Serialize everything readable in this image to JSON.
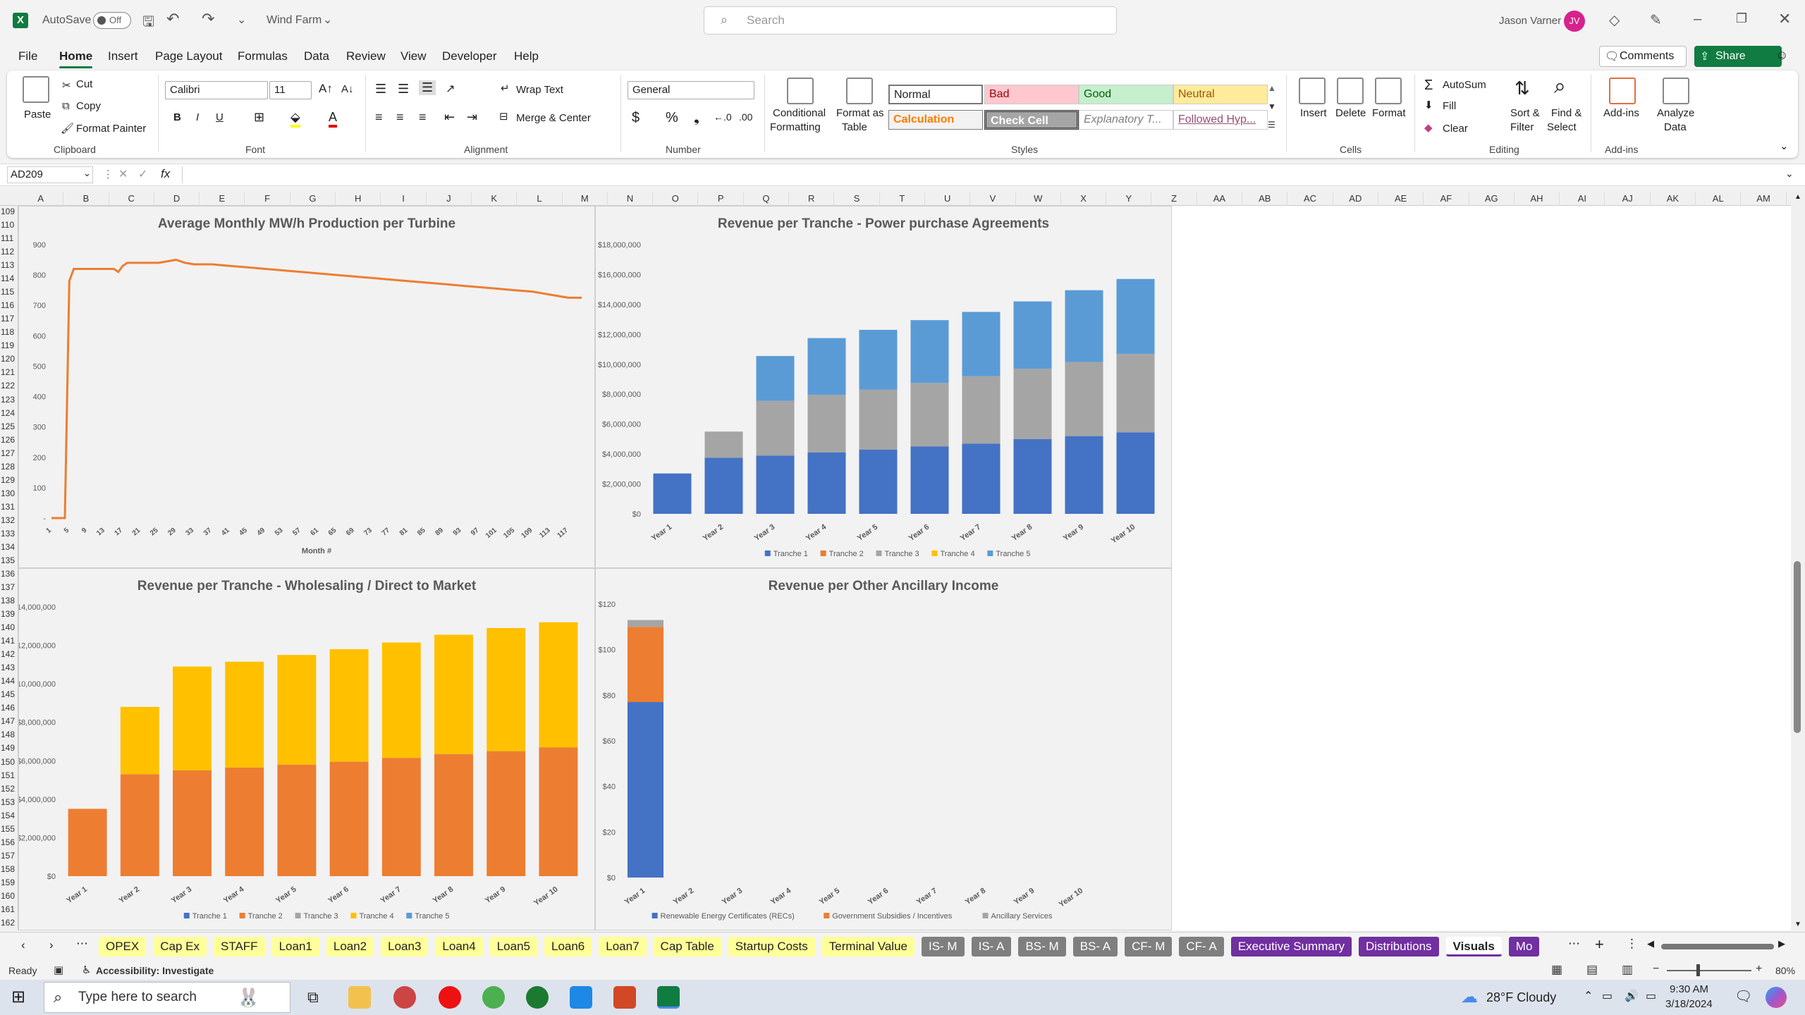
{
  "titlebar": {
    "autosave_label": "AutoSave",
    "autosave_state": "Off",
    "filename": "Wind Farm",
    "search_placeholder": "Search",
    "user_name": "Jason Varner",
    "user_initials": "JV"
  },
  "menu": [
    "File",
    "Home",
    "Insert",
    "Page Layout",
    "Formulas",
    "Data",
    "Review",
    "View",
    "Developer",
    "Help"
  ],
  "actions": {
    "comments": "Comments",
    "share": "Share"
  },
  "ribbon": {
    "clipboard": {
      "paste": "Paste",
      "cut": "Cut",
      "copy": "Copy",
      "format_painter": "Format Painter",
      "group": "Clipboard"
    },
    "font": {
      "name": "Calibri",
      "size": "11",
      "group": "Font"
    },
    "alignment": {
      "wrap": "Wrap Text",
      "merge": "Merge & Center",
      "group": "Alignment"
    },
    "number": {
      "format": "General",
      "group": "Number"
    },
    "styles": {
      "conditional": [
        "Conditional",
        "Formatting"
      ],
      "format_table": [
        "Format as",
        "Table"
      ],
      "cells": [
        "Normal",
        "Bad",
        "Good",
        "Neutral",
        "Calculation",
        "Check Cell",
        "Explanatory T...",
        "Followed Hyp..."
      ],
      "group": "Styles"
    },
    "cells": {
      "insert": "Insert",
      "delete": "Delete",
      "format": "Format",
      "group": "Cells"
    },
    "editing": {
      "autosum": "AutoSum",
      "fill": "Fill",
      "clear": "Clear",
      "sort": [
        "Sort &",
        "Filter"
      ],
      "find": [
        "Find &",
        "Select"
      ],
      "group": "Editing"
    },
    "addins": {
      "addins": "Add-ins",
      "analyze": [
        "Analyze",
        "Data"
      ],
      "group": "Add-ins"
    }
  },
  "formula_bar": {
    "name_box": "AD209",
    "fx": "fx",
    "value": ""
  },
  "columns": [
    "A",
    "B",
    "C",
    "D",
    "E",
    "F",
    "G",
    "H",
    "I",
    "J",
    "K",
    "L",
    "M",
    "N",
    "O",
    "P",
    "Q",
    "R",
    "S",
    "T",
    "U",
    "V",
    "W",
    "X",
    "Y",
    "Z",
    "AA",
    "AB",
    "AC",
    "AD",
    "AE",
    "AF",
    "AG",
    "AH",
    "AI",
    "AJ",
    "AK",
    "AL",
    "AM"
  ],
  "row_start": 109,
  "row_count": 54,
  "chart_data": [
    {
      "type": "line",
      "title": "Average Monthly MW/h Production per Turbine",
      "xlabel": "Month #",
      "ylabel": "",
      "ylim": [
        0,
        900
      ],
      "yticks": [
        "900",
        "800",
        "700",
        "600",
        "500",
        "400",
        "300",
        "200",
        "100",
        "-"
      ],
      "xticks": [
        "1",
        "5",
        "9",
        "13",
        "17",
        "21",
        "25",
        "29",
        "33",
        "37",
        "41",
        "45",
        "49",
        "53",
        "57",
        "61",
        "65",
        "69",
        "73",
        "77",
        "81",
        "85",
        "89",
        "93",
        "97",
        "101",
        "105",
        "109",
        "113",
        "117"
      ],
      "x": [
        1,
        2,
        3,
        4,
        5,
        6,
        9,
        13,
        15,
        16,
        17,
        18,
        21,
        25,
        29,
        31,
        33,
        37,
        41,
        45,
        49,
        53,
        57,
        61,
        65,
        69,
        73,
        77,
        81,
        85,
        89,
        93,
        97,
        101,
        105,
        109,
        113,
        117,
        120
      ],
      "y": [
        0,
        0,
        0,
        0,
        780,
        820,
        820,
        820,
        820,
        810,
        830,
        840,
        840,
        840,
        850,
        840,
        835,
        835,
        830,
        825,
        820,
        815,
        810,
        805,
        800,
        795,
        790,
        785,
        780,
        775,
        770,
        765,
        760,
        755,
        750,
        745,
        735,
        725,
        725
      ],
      "series": [
        {
          "name": "",
          "color": "#ed7d31"
        }
      ]
    },
    {
      "type": "bar",
      "stacked": true,
      "title": "Revenue per Tranche - Power purchase Agreements",
      "categories": [
        "Year 1",
        "Year 2",
        "Year 3",
        "Year 4",
        "Year 5",
        "Year 6",
        "Year 7",
        "Year 8",
        "Year 9",
        "Year 10"
      ],
      "ylim": [
        0,
        18000000
      ],
      "yticks": [
        "$18,000,000",
        "$16,000,000",
        "$14,000,000",
        "$12,000,000",
        "$10,000,000",
        "$8,000,000",
        "$6,000,000",
        "$4,000,000",
        "$2,000,000",
        "$0"
      ],
      "series": [
        {
          "name": "Tranche 1",
          "color": "#4472c4",
          "values": [
            2700000,
            3750000,
            3900000,
            4100000,
            4300000,
            4500000,
            4700000,
            5000000,
            5200000,
            5450000
          ]
        },
        {
          "name": "Tranche 2",
          "color": "#ed7d31",
          "values": [
            0,
            0,
            0,
            0,
            0,
            0,
            0,
            0,
            0,
            0
          ]
        },
        {
          "name": "Tranche 3",
          "color": "#a5a5a5",
          "values": [
            0,
            1750000,
            3650000,
            3850000,
            4000000,
            4250000,
            4500000,
            4700000,
            4950000,
            5250000
          ]
        },
        {
          "name": "Tranche 4",
          "color": "#ffc000",
          "values": [
            0,
            0,
            0,
            0,
            0,
            0,
            0,
            0,
            0,
            0
          ]
        },
        {
          "name": "Tranche 5",
          "color": "#5b9bd5",
          "values": [
            0,
            0,
            3000000,
            3800000,
            4000000,
            4200000,
            4300000,
            4500000,
            4800000,
            5000000
          ]
        }
      ]
    },
    {
      "type": "bar",
      "stacked": true,
      "title": "Revenue per Tranche - Wholesaling / Direct to Market",
      "categories": [
        "Year 1",
        "Year 2",
        "Year 3",
        "Year 4",
        "Year 5",
        "Year 6",
        "Year 7",
        "Year 8",
        "Year 9",
        "Year 10"
      ],
      "ylim": [
        0,
        14000000
      ],
      "yticks": [
        "$14,000,000",
        "$12,000,000",
        "$10,000,000",
        "$8,000,000",
        "$6,000,000",
        "$4,000,000",
        "$2,000,000",
        "$0"
      ],
      "series": [
        {
          "name": "Tranche 1",
          "color": "#4472c4",
          "values": [
            0,
            0,
            0,
            0,
            0,
            0,
            0,
            0,
            0,
            0
          ]
        },
        {
          "name": "Tranche 2",
          "color": "#ed7d31",
          "values": [
            3500000,
            5300000,
            5500000,
            5650000,
            5800000,
            5950000,
            6150000,
            6350000,
            6500000,
            6700000
          ]
        },
        {
          "name": "Tranche 3",
          "color": "#a5a5a5",
          "values": [
            0,
            0,
            0,
            0,
            0,
            0,
            0,
            0,
            0,
            0
          ]
        },
        {
          "name": "Tranche 4",
          "color": "#ffc000",
          "values": [
            0,
            3500000,
            5400000,
            5500000,
            5700000,
            5850000,
            6000000,
            6200000,
            6400000,
            6500000
          ]
        },
        {
          "name": "Tranche 5",
          "color": "#5b9bd5",
          "values": [
            0,
            0,
            0,
            0,
            0,
            0,
            0,
            0,
            0,
            0
          ]
        }
      ]
    },
    {
      "type": "bar",
      "stacked": true,
      "title": "Revenue per Other Ancillary Income",
      "categories": [
        "Year 1",
        "Year 2",
        "Year 3",
        "Year 4",
        "Year 5",
        "Year 6",
        "Year 7",
        "Year 8",
        "Year 9",
        "Year 10"
      ],
      "ylim": [
        0,
        120
      ],
      "yticks": [
        "$120",
        "$100",
        "$80",
        "$60",
        "$40",
        "$20",
        "$0"
      ],
      "series": [
        {
          "name": "Renewable Energy Certificates (RECs)",
          "color": "#4472c4",
          "values": [
            77,
            0,
            0,
            0,
            0,
            0,
            0,
            0,
            0,
            0
          ]
        },
        {
          "name": "Government Subsidies / Incentives",
          "color": "#ed7d31",
          "values": [
            33,
            0,
            0,
            0,
            0,
            0,
            0,
            0,
            0,
            0
          ]
        },
        {
          "name": "Ancillary Services",
          "color": "#a5a5a5",
          "values": [
            3,
            0,
            0,
            0,
            0,
            0,
            0,
            0,
            0,
            0
          ]
        }
      ]
    }
  ],
  "sheets": [
    {
      "name": "OPEX",
      "style": "y"
    },
    {
      "name": "Cap Ex",
      "style": "y"
    },
    {
      "name": "STAFF",
      "style": "y"
    },
    {
      "name": "Loan1",
      "style": "y"
    },
    {
      "name": "Loan2",
      "style": "y"
    },
    {
      "name": "Loan3",
      "style": "y"
    },
    {
      "name": "Loan4",
      "style": "y"
    },
    {
      "name": "Loan5",
      "style": "y"
    },
    {
      "name": "Loan6",
      "style": "y"
    },
    {
      "name": "Loan7",
      "style": "y"
    },
    {
      "name": "Cap Table",
      "style": "y"
    },
    {
      "name": "Startup Costs",
      "style": "y"
    },
    {
      "name": "Terminal Value",
      "style": "y"
    },
    {
      "name": "IS- M",
      "style": "g"
    },
    {
      "name": "IS- A",
      "style": "g"
    },
    {
      "name": "BS- M",
      "style": "g"
    },
    {
      "name": "BS- A",
      "style": "g"
    },
    {
      "name": "CF- M",
      "style": "g"
    },
    {
      "name": "CF- A",
      "style": "g"
    },
    {
      "name": "Executive Summary",
      "style": "p"
    },
    {
      "name": "Distributions",
      "style": "p"
    },
    {
      "name": "Visuals",
      "style": "sel"
    },
    {
      "name": "Mo",
      "style": "p"
    }
  ],
  "status": {
    "ready": "Ready",
    "accessibility": "Accessibility: Investigate",
    "zoom": "80%"
  },
  "taskbar": {
    "search_placeholder": "Type here to search",
    "weather": "28°F  Cloudy",
    "time": "9:30 AM",
    "date": "3/18/2024"
  }
}
